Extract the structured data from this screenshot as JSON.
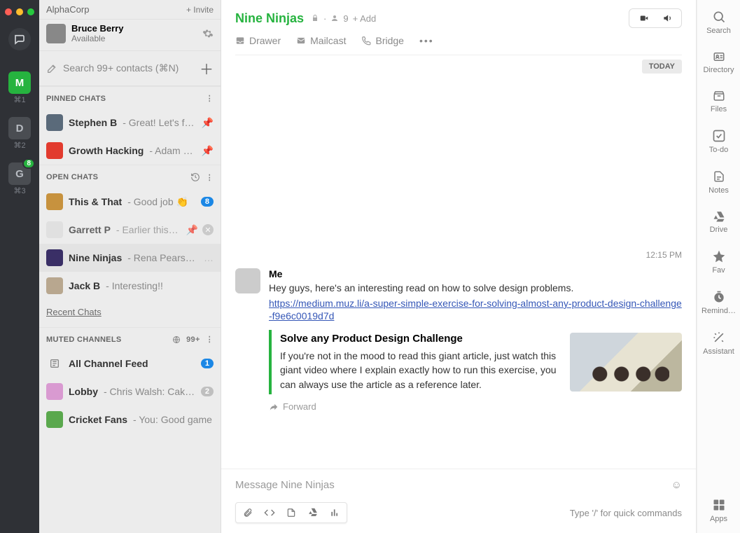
{
  "rail": {
    "items": [
      {
        "letter": "M",
        "key": "⌘1"
      },
      {
        "letter": "D",
        "key": "⌘2"
      },
      {
        "letter": "G",
        "key": "⌘3",
        "badge": "8"
      }
    ]
  },
  "sidebar": {
    "org": "AlphaCorp",
    "invite": "+ Invite",
    "profile": {
      "name": "Bruce Berry",
      "status": "Available"
    },
    "search_placeholder": "Search 99+ contacts (⌘N)",
    "sections": {
      "pinned": "PINNED CHATS",
      "open": "OPEN CHATS",
      "muted": "MUTED CHANNELS",
      "recent": "Recent Chats",
      "muted_count": "99+"
    },
    "pinned": [
      {
        "title": "Stephen B",
        "preview": "- Great! Let's fin…",
        "av_bg": "#5a6a7a"
      },
      {
        "title": "Growth Hacking",
        "preview": "- Adam W…",
        "av_bg": "#e23b2e"
      }
    ],
    "open": [
      {
        "title": "This & That",
        "preview": "- Good job 👏",
        "badge": "8",
        "av_bg": "#c7923e"
      },
      {
        "title": "Garrett P",
        "preview": "- Earlier this…",
        "pinclose": true,
        "av_bg": "#dcdcdc"
      },
      {
        "title": "Nine Ninjas",
        "preview": "- Rena Pearson: …",
        "active": true,
        "av_bg": "#3a2f66"
      },
      {
        "title": "Jack B",
        "preview": "- Interesting!!",
        "av_bg": "#b8a78f"
      }
    ],
    "muted": [
      {
        "title": "All Channel Feed",
        "preview": "",
        "badge": "1",
        "badge_blue": true,
        "icon": "feed"
      },
      {
        "title": "Lobby",
        "preview": "- Chris Walsh: Cake…",
        "badge": "2",
        "av_bg": "#d99ad1"
      },
      {
        "title": "Cricket Fans",
        "preview": "- You: Good game",
        "av_bg": "#5aa84d"
      }
    ]
  },
  "header": {
    "title": "Nine Ninjas",
    "members": "9",
    "add": "+ Add",
    "menu": {
      "drawer": "Drawer",
      "mailcast": "Mailcast",
      "bridge": "Bridge"
    }
  },
  "chat": {
    "day": "TODAY",
    "time": "12:15 PM",
    "message": {
      "author": "Me",
      "text": "Hey guys, here's an interesting read on how to solve design problems.",
      "link": "https://medium.muz.li/a-super-simple-exercise-for-solving-almost-any-product-design-challenge-f9e6c0019d7d",
      "embed": {
        "title": "Solve any Product Design Challenge",
        "desc": "If you're not in the mood to read this giant article, just watch this giant video where I explain exactly how to run this exercise, you can always use the article as a reference later."
      },
      "forward": "Forward"
    }
  },
  "composer": {
    "placeholder": "Message Nine Ninjas",
    "hint": "Type '/' for quick commands"
  },
  "right_rail": {
    "items": [
      {
        "label": "Search",
        "icon": "search"
      },
      {
        "label": "Directory",
        "icon": "card"
      },
      {
        "label": "Files",
        "icon": "box"
      },
      {
        "label": "To-do",
        "icon": "check"
      },
      {
        "label": "Notes",
        "icon": "note"
      },
      {
        "label": "Drive",
        "icon": "drive"
      },
      {
        "label": "Fav",
        "icon": "star"
      },
      {
        "label": "Remind…",
        "icon": "clock"
      },
      {
        "label": "Assistant",
        "icon": "wand"
      }
    ],
    "apps": "Apps"
  }
}
